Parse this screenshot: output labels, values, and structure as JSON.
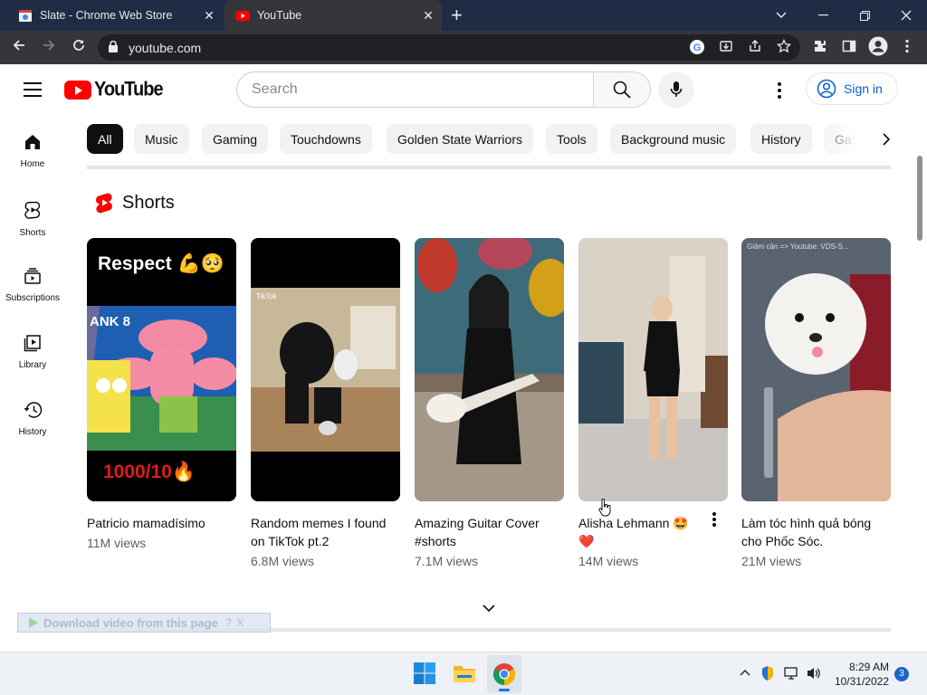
{
  "browser": {
    "tabs": [
      {
        "title": "Slate - Chrome Web Store"
      },
      {
        "title": "YouTube"
      }
    ],
    "url": "youtube.com"
  },
  "youtube": {
    "logo_text": "YouTube",
    "search_placeholder": "Search",
    "signin_label": "Sign in",
    "sidebar": [
      {
        "label": "Home",
        "icon": "home-icon"
      },
      {
        "label": "Shorts",
        "icon": "shorts-icon"
      },
      {
        "label": "Subscriptions",
        "icon": "subscriptions-icon"
      },
      {
        "label": "Library",
        "icon": "library-icon"
      },
      {
        "label": "History",
        "icon": "history-icon"
      }
    ],
    "chips": [
      "All",
      "Music",
      "Gaming",
      "Touchdowns",
      "Golden State Warriors",
      "Tools",
      "Background music",
      "History",
      "Ga"
    ],
    "shorts_title": "Shorts",
    "shorts": [
      {
        "title": "Patricio mamadísimo",
        "views": "11M views",
        "overlay_top": "Respect 💪🥺",
        "overlay_bottom": "1000/10🔥",
        "badge": "ANK 8"
      },
      {
        "title": "Random memes I found on TikTok pt.2",
        "views": "6.8M views",
        "overlay_top": "TikTok"
      },
      {
        "title": "Amazing Guitar Cover #shorts",
        "views": "7.1M views"
      },
      {
        "title": "Alisha Lehmann 🤩 ❤️",
        "views": "14M views"
      },
      {
        "title": "Làm tóc hình quả bóng cho Phốc Sóc.",
        "views": "21M views",
        "overlay_top": "Giảm cân => Youtube: VDS-S..."
      }
    ]
  },
  "download_bar": {
    "text": "Download video from this page",
    "help": "?",
    "close": "X"
  },
  "taskbar": {
    "time": "8:29 AM",
    "date": "10/31/2022",
    "notification_count": "3"
  },
  "colors": {
    "youtube_red": "#ff0000",
    "link_blue": "#065fd4",
    "chrome_dark": "#35363a",
    "tabstrip": "#202b45"
  }
}
